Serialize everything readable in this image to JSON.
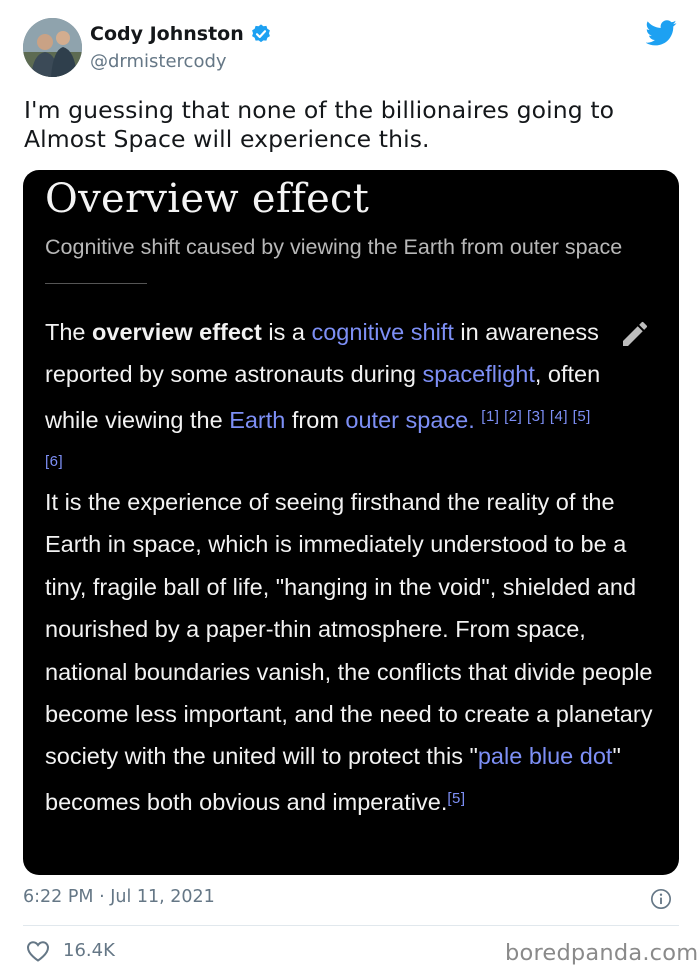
{
  "author": {
    "name": "Cody Johnston",
    "handle": "@drmistercody"
  },
  "tweet": {
    "text": "I'm guessing that none of the billionaires going to Almost Space will experience this.",
    "time": "6:22 PM · Jul 11, 2021",
    "likes": "16.4K"
  },
  "wiki": {
    "title": "Overview effect",
    "description": "Cognitive shift caused by viewing the Earth from outer space",
    "p1": {
      "t1": "The ",
      "bold": "overview effect",
      "t2": " is a ",
      "link1": "cognitive shift",
      "t3": " in awareness reported by some astronauts during ",
      "link2": "spaceflight",
      "t4": ", often while viewing the ",
      "link3": "Earth",
      "t5": " from ",
      "link4": "outer space",
      "t6": ". ",
      "refs": "[1] [2] [3] [4] [5] [6]"
    },
    "p2": {
      "t1": "It is the experience of seeing firsthand the reality of the Earth in space, which is immediately understood to be a tiny, fragile ball of life, \"hanging in the void\", shielded and nourished by a paper-thin atmosphere. From space, national boundaries vanish, the conflicts that divide people become less important, and the need to create a planetary society with the united will to protect this \"",
      "link": "pale blue dot",
      "t2": "\" becomes both obvious and imperative.",
      "ref": "[5]"
    }
  },
  "watermark": "boredpanda.com",
  "colors": {
    "twitter_blue": "#1da1f2",
    "wiki_link": "#7d8ff5",
    "card_bg": "#000000",
    "meta_gray": "#657786"
  },
  "icons": [
    "verified-badge-icon",
    "twitter-bird-icon",
    "edit-pencil-icon",
    "info-icon",
    "heart-icon"
  ]
}
